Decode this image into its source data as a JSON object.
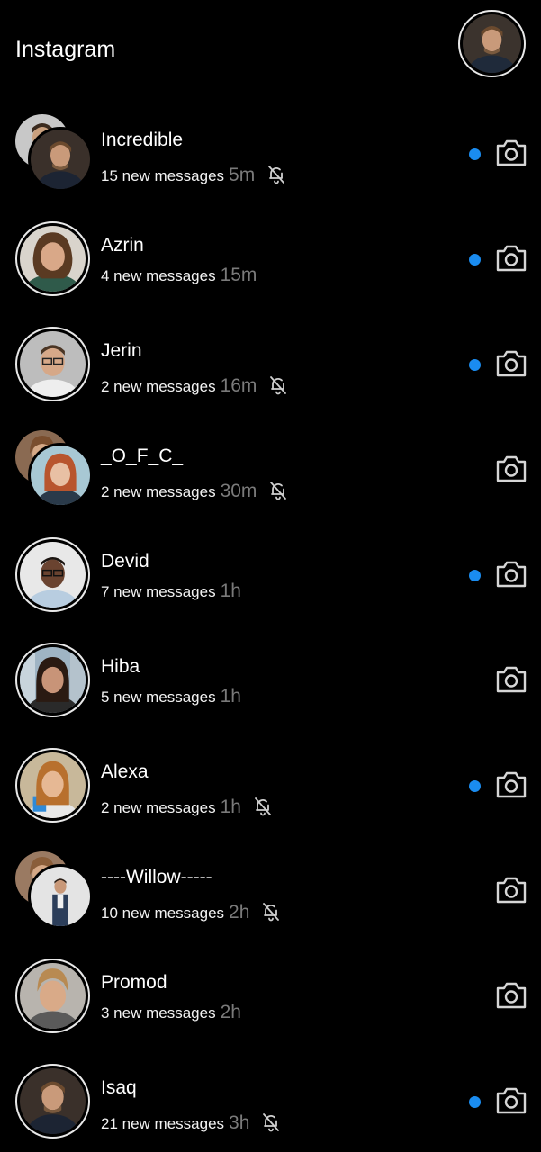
{
  "header": {
    "title": "Instagram",
    "profile_icon": "profile-avatar"
  },
  "colors": {
    "background": "#000000",
    "unread_dot": "#1a8cf0",
    "time_text": "#7a7a7a"
  },
  "threads": [
    {
      "name": "Incredible",
      "preview": "15 new messages",
      "time": "5m",
      "muted": true,
      "unread": true,
      "group": true
    },
    {
      "name": "Azrin",
      "preview": "4 new messages",
      "time": "15m",
      "muted": false,
      "unread": true,
      "group": false
    },
    {
      "name": "Jerin",
      "preview": "2 new messages",
      "time": "16m",
      "muted": true,
      "unread": true,
      "group": false
    },
    {
      "name": "_O_F_C_",
      "preview": "2 new messages",
      "time": "30m",
      "muted": true,
      "unread": false,
      "group": true
    },
    {
      "name": "Devid",
      "preview": "7 new messages",
      "time": "1h",
      "muted": false,
      "unread": true,
      "group": false
    },
    {
      "name": "Hiba",
      "preview": "5 new messages",
      "time": "1h",
      "muted": false,
      "unread": false,
      "group": false
    },
    {
      "name": "Alexa",
      "preview": "2 new messages",
      "time": "1h",
      "muted": true,
      "unread": true,
      "group": false
    },
    {
      "name": "----Willow-----",
      "preview": "10 new messages",
      "time": "2h",
      "muted": true,
      "unread": false,
      "group": true
    },
    {
      "name": "Promod",
      "preview": "3 new messages",
      "time": "2h",
      "muted": false,
      "unread": false,
      "group": false
    },
    {
      "name": "Isaq",
      "preview": "21 new messages",
      "time": "3h",
      "muted": true,
      "unread": true,
      "group": false
    }
  ]
}
